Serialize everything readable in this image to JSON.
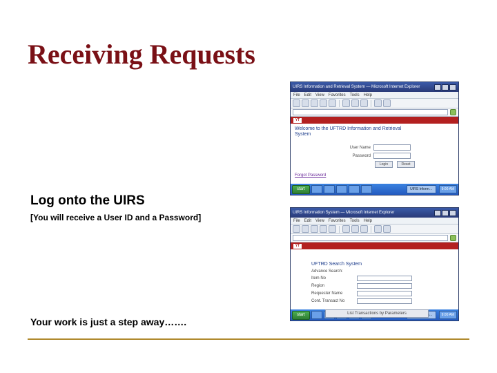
{
  "title": "Receiving Requests",
  "subtitle": "Log onto the UIRS",
  "note": "[You will receive a User ID and a Password]",
  "closing": "Your work is just a step away…….",
  "window": {
    "title1": "UIRS Information and Retrieval System — Microsoft Internet Explorer",
    "title2": "UIRS Information System — Microsoft Internet Explorer",
    "menus": [
      "File",
      "Edit",
      "View",
      "Favorites",
      "Tools",
      "Help"
    ],
    "logo": "YT"
  },
  "login": {
    "welcome_line1": "Welcome to the UFTRD Information and Retrieval",
    "welcome_line2": "System",
    "user_label": "User Name",
    "pass_label": "Password",
    "btn_login": "Login",
    "btn_reset": "Reset",
    "forgot": "Forgot Password"
  },
  "search": {
    "heading": "UFTRD Search System",
    "instruction": "Advance Search:",
    "f1": "Item No",
    "f2": "Region",
    "f3": "Requester Name",
    "f4": "Cont. Transact No",
    "button": "List Transactions by Parameters"
  },
  "taskbar": {
    "start": "start",
    "active1": "UIRS Inform…",
    "tray_time": "9:00 AM"
  }
}
